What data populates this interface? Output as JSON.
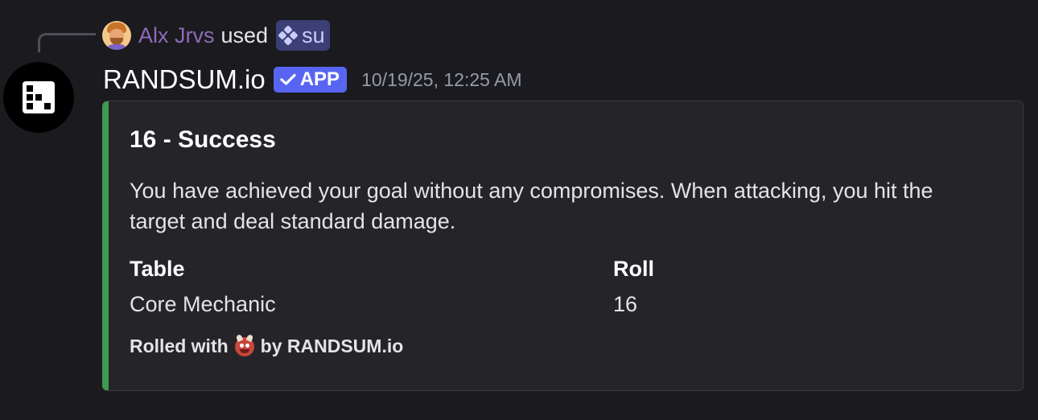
{
  "command_line": {
    "user_name": "Alx Jrvs",
    "used_text": "used",
    "command_name": "su"
  },
  "header": {
    "bot_name": "RANDSUM.io",
    "badge_label": "APP",
    "timestamp": "10/19/25, 12:25 AM"
  },
  "embed": {
    "accent_color": "#3f9a4f",
    "title": "16 - Success",
    "description": "You have achieved your goal without any compromises. When attacking, you hit the target and deal standard damage.",
    "fields": [
      {
        "name": "Table",
        "value": "Core Mechanic"
      },
      {
        "name": "Roll",
        "value": "16"
      }
    ],
    "footer": {
      "prefix": "Rolled with",
      "icon": "ogre-emoji-icon",
      "suffix": "by RANDSUM.io"
    }
  },
  "colors": {
    "background": "#1b1b1f",
    "user_name": "#8f6ab8",
    "app_badge": "#5865f2",
    "command_chip": "#3c3f75"
  }
}
